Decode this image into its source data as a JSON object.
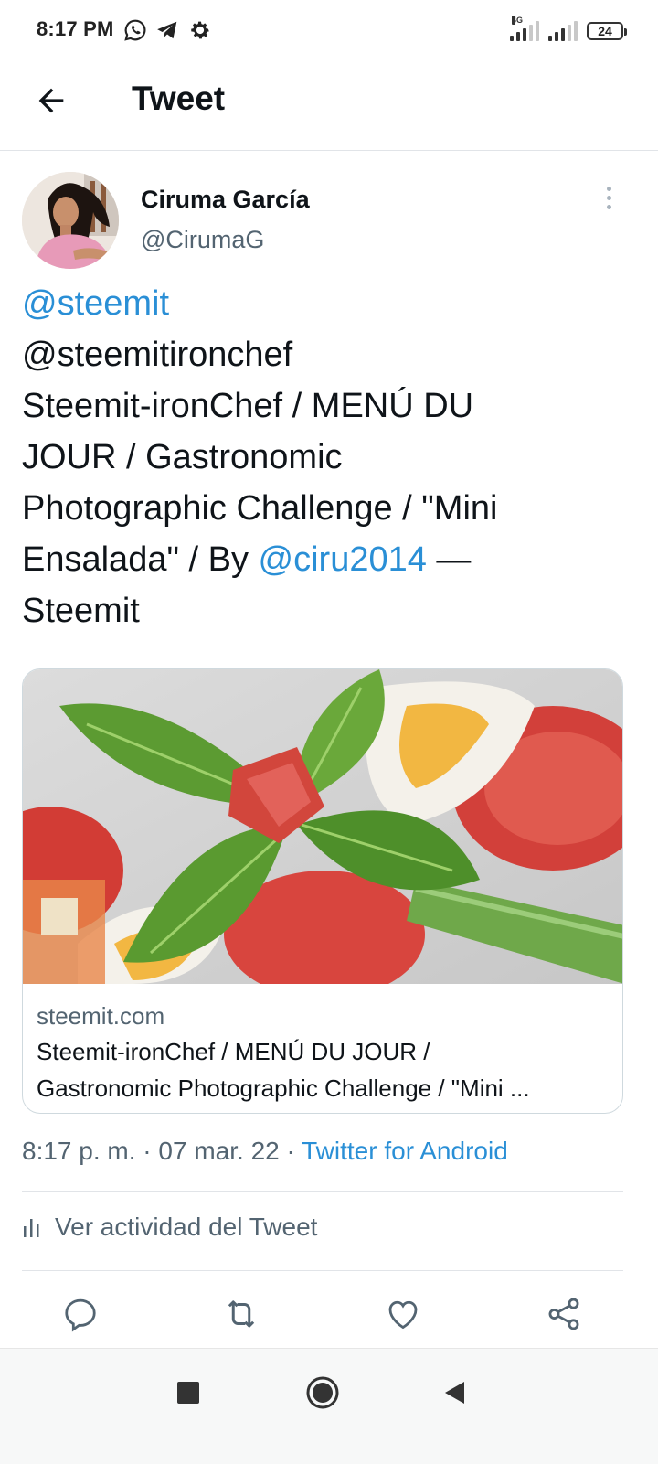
{
  "status_bar": {
    "time": "8:17 PM",
    "network": "4G",
    "battery": "24",
    "icons": [
      "whatsapp-icon",
      "telegram-icon",
      "settings-icon"
    ]
  },
  "header": {
    "title": "Tweet",
    "back_icon": "arrow-left-icon"
  },
  "tweet": {
    "author_name": "Ciruma García",
    "author_handle": "@CirumaG",
    "text_lines": [
      {
        "parts": [
          {
            "text": "@steemit",
            "link": true
          }
        ]
      },
      {
        "parts": [
          {
            "text": "@steemitironchef",
            "link": false
          }
        ]
      },
      {
        "parts": [
          {
            "text": "Steemit-ironChef / MENÚ DU",
            "link": false
          }
        ]
      },
      {
        "parts": [
          {
            "text": "JOUR / Gastronomic",
            "link": false
          }
        ]
      },
      {
        "parts": [
          {
            "text": "Photographic Challenge / \"Mini",
            "link": false
          }
        ]
      },
      {
        "parts": [
          {
            "text": "Ensalada\" / By ",
            "link": false
          },
          {
            "text": "@ciru2014",
            "link": true
          },
          {
            "text": " —",
            "link": false
          }
        ]
      },
      {
        "parts": [
          {
            "text": "Steemit",
            "link": false
          }
        ]
      }
    ],
    "card": {
      "domain": "steemit.com",
      "title_line1": "Steemit-ironChef / MENÚ DU JOUR /",
      "title_line2": "Gastronomic Photographic Challenge / \"Mini ..."
    },
    "time": "8:17 p. m.",
    "separator": " · ",
    "date": "07 mar. 22",
    "source": "Twitter for Android",
    "activity_label": "Ver actividad del Tweet"
  },
  "actions": [
    "reply-icon",
    "retweet-icon",
    "like-icon",
    "share-icon"
  ],
  "colors": {
    "link": "#2a8fd6",
    "text": "#0f1419",
    "secondary": "#536471",
    "divider": "#e1e4e8"
  }
}
